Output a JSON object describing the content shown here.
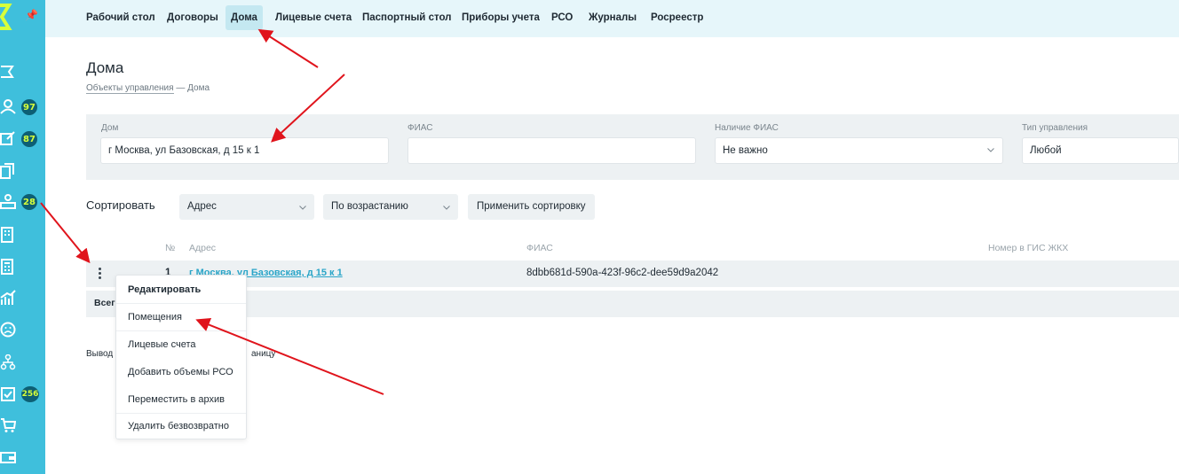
{
  "colors": {
    "sidebar": "#3fbfdc",
    "topnav": "#e6f6fa",
    "accent": "#3fbfdc",
    "badge": "#0d5f74",
    "annotation": "#e0141c"
  },
  "sidebar": {
    "items": [
      {
        "icon": "flag-icon"
      },
      {
        "icon": "users-icon",
        "badge": "97"
      },
      {
        "icon": "edit-icon",
        "badge": "87"
      },
      {
        "icon": "documents-icon"
      },
      {
        "icon": "person-desk-icon",
        "badge": "28"
      },
      {
        "icon": "building-icon"
      },
      {
        "icon": "calculator-icon"
      },
      {
        "icon": "chart-icon"
      },
      {
        "icon": "sad-face-icon"
      },
      {
        "icon": "hierarchy-icon"
      },
      {
        "icon": "tasks-icon",
        "badge": "256"
      },
      {
        "icon": "cart-icon"
      },
      {
        "icon": "wallet-icon"
      }
    ]
  },
  "nav": {
    "items": [
      "Рабочий стол",
      "Договоры",
      "Дома",
      "Лицевые счета",
      "Паспортный стол",
      "Приборы учета",
      "РСО",
      "Журналы",
      "Росреестр"
    ],
    "active": "Дома"
  },
  "page": {
    "title": "Дома",
    "breadcrumb_link": "Объекты управления",
    "breadcrumb_sep": "—",
    "breadcrumb_current": "Дома"
  },
  "filters": {
    "house": {
      "label": "Дом",
      "value": "г Москва, ул Базовская, д 15 к 1"
    },
    "fias": {
      "label": "ФИАС",
      "value": ""
    },
    "fias_presence": {
      "label": "Наличие ФИАС",
      "value": "Не важно"
    },
    "management_type": {
      "label": "Тип управления",
      "value": "Любой"
    }
  },
  "sort": {
    "label": "Сортировать",
    "field": "Адрес",
    "order": "По возрастанию",
    "apply": "Применить сортировку"
  },
  "table": {
    "columns": [
      "№",
      "Адрес",
      "ФИАС",
      "Номер в ГИС ЖКХ"
    ],
    "rows": [
      {
        "num": "1",
        "address": "г Москва, ул Базовская, д 15 к 1",
        "fias": "8dbb681d-590a-423f-96c2-dee59d9a2042",
        "gis": ""
      }
    ],
    "total_label": "Всег"
  },
  "output": {
    "left": "Вывод",
    "right": "аницу"
  },
  "context_menu": {
    "items": [
      "Редактировать",
      "Помещения",
      "Лицевые счета",
      "Добавить объемы РСО",
      "Переместить в архив",
      "Удалить безвозвратно"
    ]
  }
}
